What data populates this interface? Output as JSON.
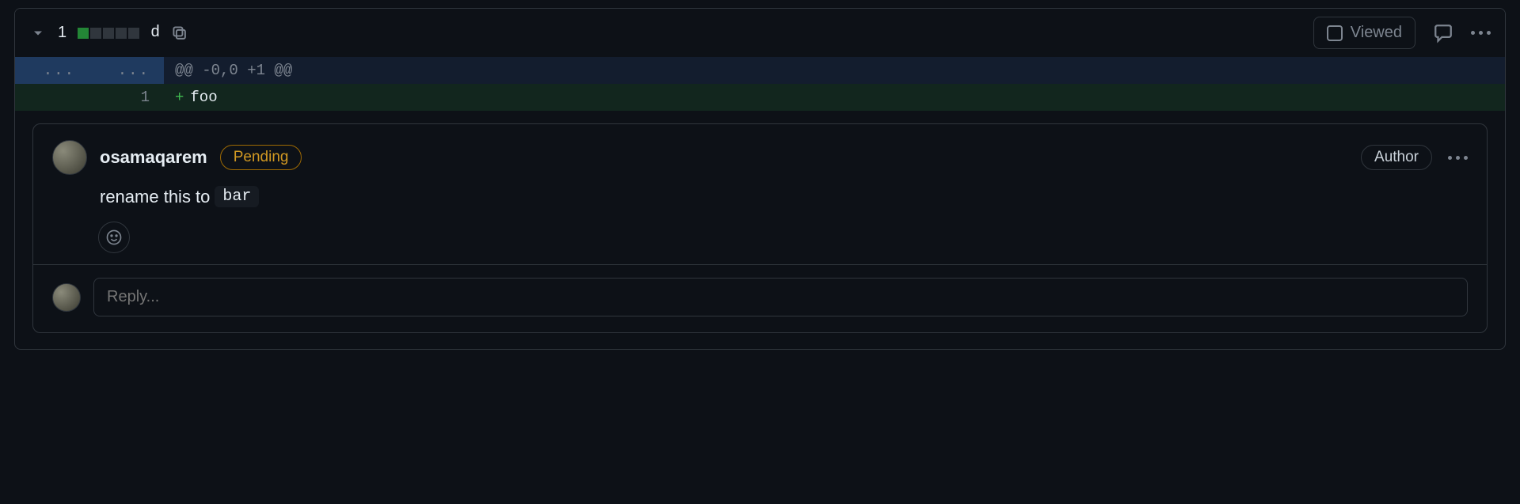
{
  "header": {
    "change_count": "1",
    "filename": "d",
    "viewed_label": "Viewed"
  },
  "diff": {
    "hunk_header": "@@ -0,0 +1 @@",
    "added_line_num": "1",
    "added_marker": "+",
    "added_code": "foo"
  },
  "comment": {
    "username": "osamaqarem",
    "pending_label": "Pending",
    "author_label": "Author",
    "body_prefix": "rename this to ",
    "body_code": "bar"
  },
  "reply": {
    "placeholder": "Reply..."
  }
}
